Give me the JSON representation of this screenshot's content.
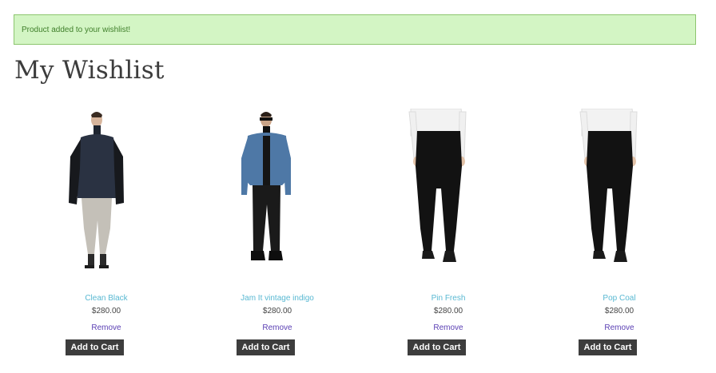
{
  "notice": {
    "text": "Product added to your wishlist!"
  },
  "page": {
    "title": "My Wishlist"
  },
  "items": [
    {
      "name": "Clean Black",
      "price": "$280.00",
      "remove_label": "Remove",
      "cart_label": "Add to Cart",
      "image": "model-sweater-pants"
    },
    {
      "name": "Jam It vintage indigo",
      "price": "$280.00",
      "remove_label": "Remove",
      "cart_label": "Add to Cart",
      "image": "model-denim-jacket"
    },
    {
      "name": "Pin Fresh",
      "price": "$280.00",
      "remove_label": "Remove",
      "cart_label": "Add to Cart",
      "image": "black-pants-back"
    },
    {
      "name": "Pop Coal",
      "price": "$280.00",
      "remove_label": "Remove",
      "cart_label": "Add to Cart",
      "image": "black-pants-back"
    }
  ],
  "colors": {
    "notice_bg": "#d3f5c4",
    "link": "#58b8d2",
    "remove": "#5a3fb3",
    "button": "#3d3d3d"
  }
}
